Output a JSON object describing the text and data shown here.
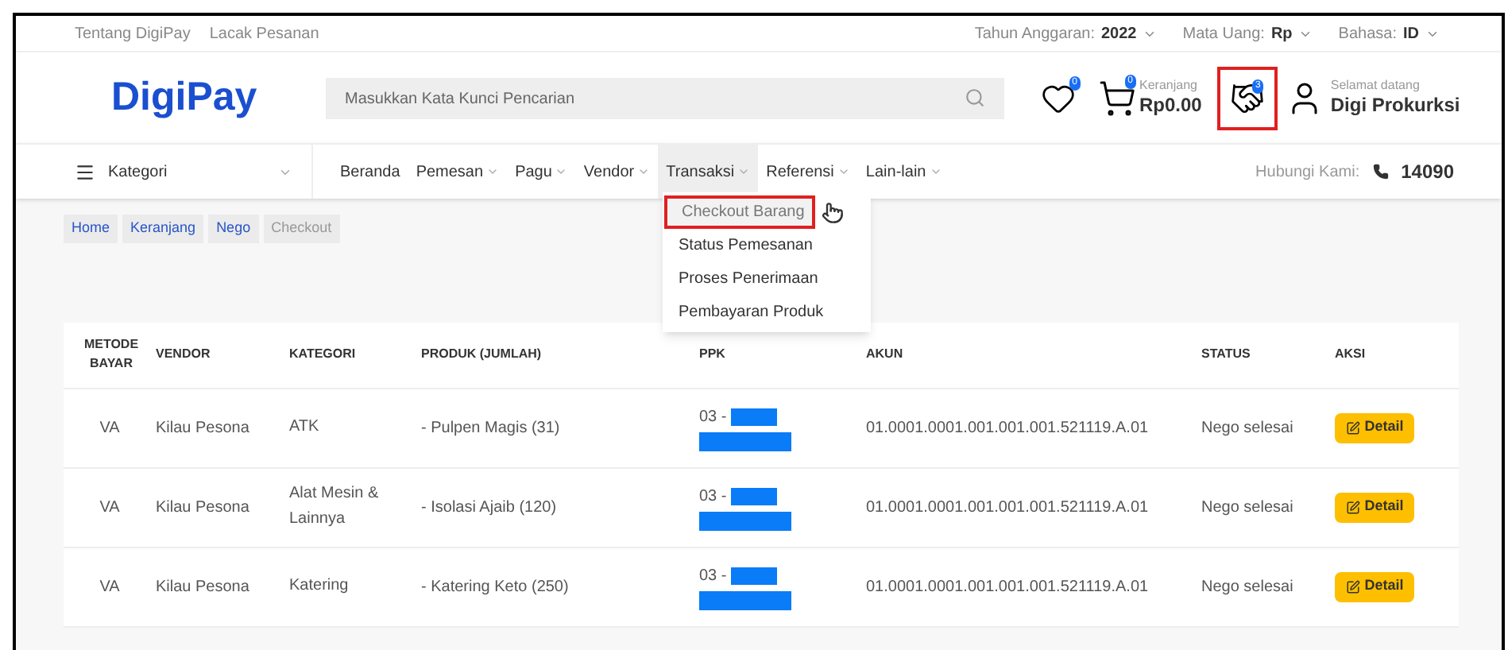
{
  "top_links": [
    "Tentang DigiPay",
    "Lacak Pesanan"
  ],
  "top_settings": [
    {
      "label": "Tahun Anggaran:",
      "value": "2022"
    },
    {
      "label": "Mata Uang:",
      "value": "Rp"
    },
    {
      "label": "Bahasa:",
      "value": "ID"
    }
  ],
  "logo": "DigiPay",
  "search": {
    "placeholder": "Masukkan Kata Kunci Pencarian"
  },
  "wishlist": {
    "count": "0"
  },
  "cart": {
    "count": "0",
    "label": "Keranjang",
    "total": "Rp0.00"
  },
  "nego": {
    "count": "3",
    "highlighted": true
  },
  "user": {
    "greeting": "Selamat datang",
    "name": "Digi Prokurksi"
  },
  "category_menu": "Kategori",
  "nav": [
    {
      "label": "Beranda",
      "dropdown": false,
      "selected": false
    },
    {
      "label": "Pemesan",
      "dropdown": true,
      "selected": false
    },
    {
      "label": "Pagu",
      "dropdown": true,
      "selected": false
    },
    {
      "label": "Vendor",
      "dropdown": true,
      "selected": false
    },
    {
      "label": "Transaksi",
      "dropdown": true,
      "selected": true
    },
    {
      "label": "Referensi",
      "dropdown": true,
      "selected": false
    },
    {
      "label": "Lain-lain",
      "dropdown": true,
      "selected": false
    }
  ],
  "contact": {
    "label": "Hubungi Kami:",
    "phone": "14090"
  },
  "dropdown_menu": [
    {
      "label": "Checkout Barang",
      "highlighted": true
    },
    {
      "label": "Status Pemesanan",
      "highlighted": false
    },
    {
      "label": "Proses Penerimaan",
      "highlighted": false
    },
    {
      "label": "Pembayaran Produk",
      "highlighted": false
    }
  ],
  "breadcrumb": [
    {
      "label": "Home",
      "current": false
    },
    {
      "label": "Keranjang",
      "current": false
    },
    {
      "label": "Nego",
      "current": false
    },
    {
      "label": "Checkout",
      "current": true
    }
  ],
  "table": {
    "columns": [
      "METODE BAYAR",
      "VENDOR",
      "KATEGORI",
      "PRODUK (JUMLAH)",
      "PPK",
      "AKUN",
      "STATUS",
      "AKSI"
    ],
    "rows": [
      {
        "metode": "VA",
        "vendor": "Kilau Pesona",
        "kategori": "ATK",
        "produk": "- Pulpen Magis (31)",
        "ppk": "03 -",
        "ppk_redacted": true,
        "akun": "01.0001.0001.001.001.001.521119.A.01",
        "status": "Nego selesai",
        "action": "Detail"
      },
      {
        "metode": "VA",
        "vendor": "Kilau Pesona",
        "kategori": "Alat Mesin & Lainnya",
        "produk": "- Isolasi Ajaib (120)",
        "ppk": "03 -",
        "ppk_redacted": true,
        "akun": "01.0001.0001.001.001.001.521119.A.01",
        "status": "Nego selesai",
        "action": "Detail"
      },
      {
        "metode": "VA",
        "vendor": "Kilau Pesona",
        "kategori": "Katering",
        "produk": "- Katering Keto (250)",
        "ppk": "03 -",
        "ppk_redacted": true,
        "akun": "01.0001.0001.001.001.001.521119.A.01",
        "status": "Nego selesai",
        "action": "Detail"
      }
    ]
  }
}
